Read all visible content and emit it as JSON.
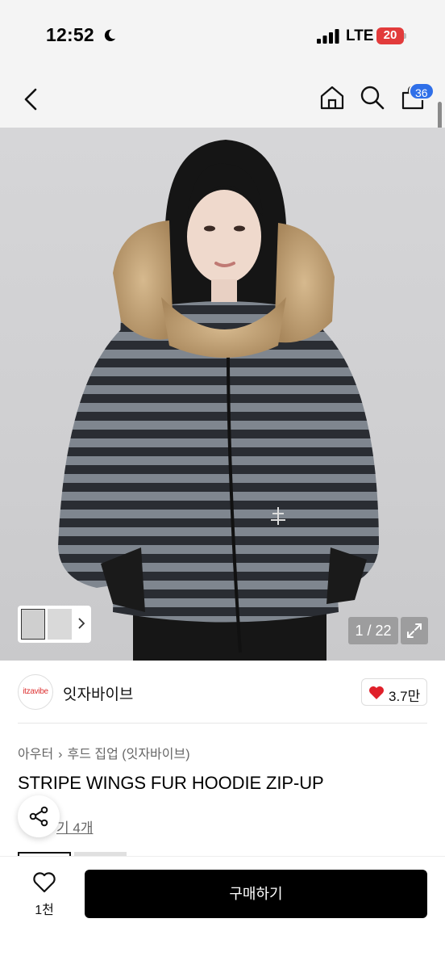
{
  "status_bar": {
    "time": "12:52",
    "network": "LTE",
    "battery": "20"
  },
  "header": {
    "cart_count": "36"
  },
  "gallery": {
    "counter": "1 / 22"
  },
  "brand": {
    "logo_text": "itzavibe",
    "name": "잇자바이브",
    "likes": "3.7만"
  },
  "breadcrumb": {
    "category": "아우터",
    "subcategory": "후드 집업 (잇자바이브)"
  },
  "product": {
    "title": "STRIPE WINGS FUR HOODIE ZIP-UP",
    "review_link": "기 4개"
  },
  "bottom_bar": {
    "wish_count": "1천",
    "buy_label": "구매하기"
  },
  "colors": {
    "accent_blue": "#2f6fe8",
    "heart_red": "#e0202a",
    "buy_black": "#000000"
  }
}
